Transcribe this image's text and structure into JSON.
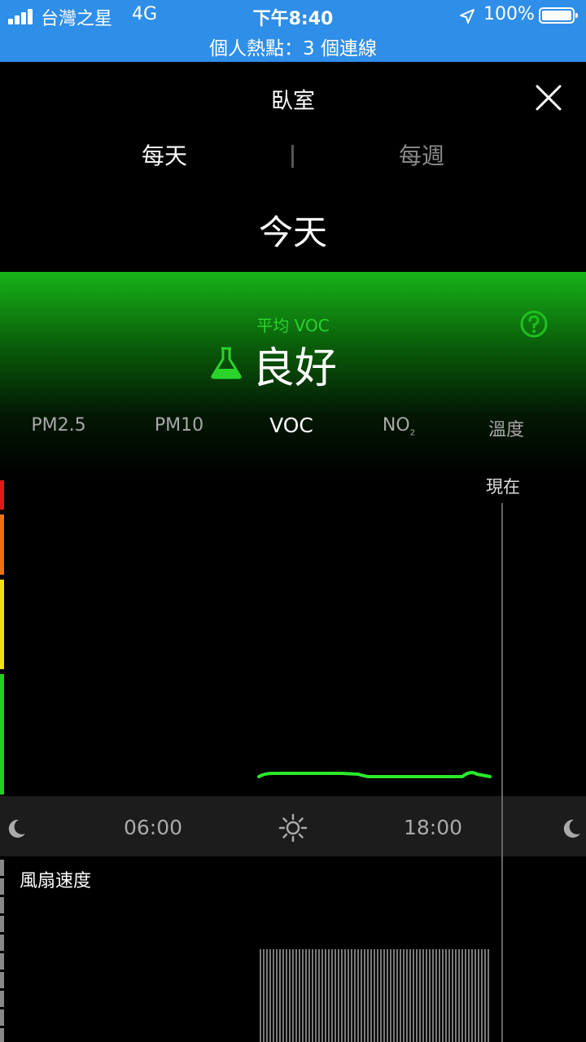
{
  "status_bar": {
    "carrier": "台灣之星",
    "network": "4G",
    "time": "下午8:40",
    "battery": "100%",
    "hotspot": "個人熱點：3 個連線"
  },
  "header": {
    "room": "臥室",
    "tabs": [
      {
        "label": "每天",
        "active": true
      },
      {
        "label": "每週",
        "active": false
      }
    ],
    "date_label": "今天"
  },
  "summary": {
    "avg_label": "平均 VOC",
    "quality": "良好",
    "accent_color": "#2ad42a"
  },
  "pollutants": [
    {
      "label": "PM2.5"
    },
    {
      "label": "PM10"
    },
    {
      "label": "VOC",
      "selected": true
    },
    {
      "label": "NO",
      "sub": "2"
    },
    {
      "label": "溫度"
    }
  ],
  "chart": {
    "now_label": "現在",
    "scale_colors": [
      "#e01818",
      "#f07010",
      "#f0e010",
      "#20d020"
    ],
    "line_color": "#2aea2a"
  },
  "timeline": {
    "labels": [
      "06:00",
      "18:00"
    ],
    "icons": [
      "moon-icon",
      "sun-icon",
      "moon-icon"
    ]
  },
  "fan": {
    "label": "風扇速度"
  }
}
